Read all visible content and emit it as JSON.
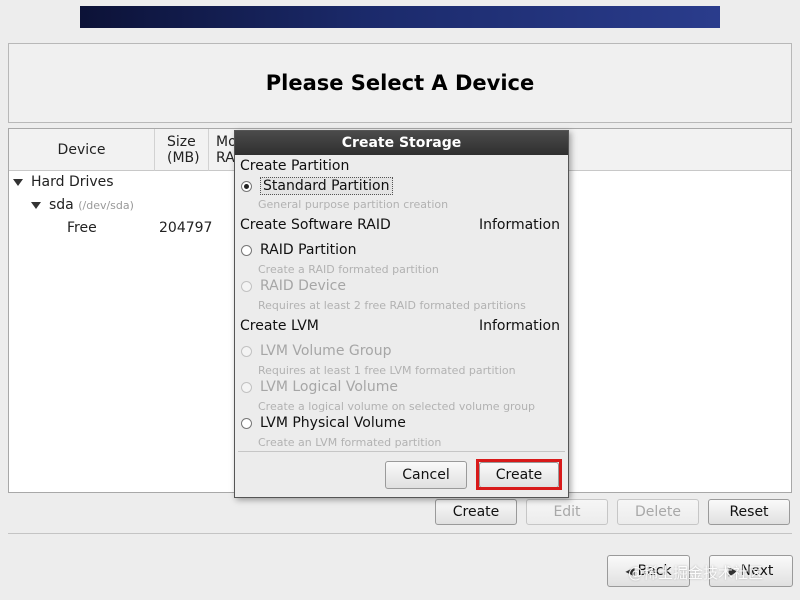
{
  "header": {
    "title": "Please Select A Device"
  },
  "tree": {
    "columns": {
      "device": "Device",
      "size": "Size\n(MB)",
      "mount": "Mo\nRA"
    },
    "rows": [
      {
        "label": "Hard Drives",
        "sub": "",
        "size": ""
      },
      {
        "label": "sda",
        "sub": "(/dev/sda)",
        "size": ""
      },
      {
        "label": "Free",
        "sub": "",
        "size": "204797"
      }
    ]
  },
  "actions": {
    "create": "Create",
    "edit": "Edit",
    "delete": "Delete",
    "reset": "Reset"
  },
  "nav": {
    "back": "Back",
    "next": "Next"
  },
  "watermark": "@稀土掘金技术社区",
  "dialog": {
    "title": "Create Storage",
    "sections": {
      "partition": "Create Partition",
      "raid": "Create Software RAID",
      "lvm": "Create LVM",
      "info": "Information"
    },
    "options": {
      "standard": {
        "label": "Standard Partition",
        "desc": "General purpose partition creation",
        "selected": true,
        "enabled": true
      },
      "raid_partition": {
        "label": "RAID Partition",
        "desc": "Create a RAID formated partition",
        "selected": false,
        "enabled": true
      },
      "raid_device": {
        "label": "RAID Device",
        "desc": "Requires at least 2 free RAID formated partitions",
        "selected": false,
        "enabled": false
      },
      "lvm_vg": {
        "label": "LVM Volume Group",
        "desc": "Requires at least 1 free LVM formated partition",
        "selected": false,
        "enabled": false
      },
      "lvm_lv": {
        "label": "LVM Logical Volume",
        "desc": "Create a logical volume on selected volume group",
        "selected": false,
        "enabled": false
      },
      "lvm_pv": {
        "label": "LVM Physical Volume",
        "desc": "Create an LVM formated partition",
        "selected": false,
        "enabled": true
      }
    },
    "buttons": {
      "cancel": "Cancel",
      "create": "Create"
    }
  },
  "icons": {
    "back": "arrow-left-icon",
    "next": "arrow-right-icon",
    "expander": "triangle-down-icon"
  },
  "colors": {
    "highlight": "#d81a1a",
    "banner": "#1b2a6b"
  }
}
